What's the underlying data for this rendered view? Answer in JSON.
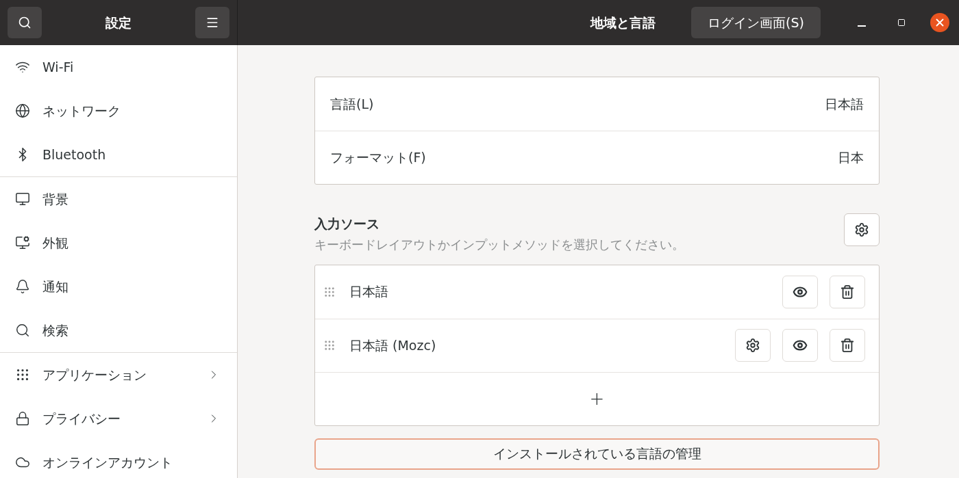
{
  "sidebar": {
    "title": "設定",
    "groups": [
      {
        "items": [
          {
            "label": "Wi-Fi",
            "kind": "page"
          },
          {
            "label": "ネットワーク",
            "kind": "page"
          },
          {
            "label": "Bluetooth",
            "kind": "page"
          }
        ]
      },
      {
        "items": [
          {
            "label": "背景",
            "kind": "page"
          },
          {
            "label": "外観",
            "kind": "page"
          },
          {
            "label": "通知",
            "kind": "page"
          },
          {
            "label": "検索",
            "kind": "page"
          }
        ]
      },
      {
        "items": [
          {
            "label": "アプリケーション",
            "kind": "submenu"
          },
          {
            "label": "プライバシー",
            "kind": "submenu"
          },
          {
            "label": "オンラインアカウント",
            "kind": "page"
          }
        ]
      }
    ]
  },
  "window": {
    "title": "地域と言語",
    "login_button": "ログイン画面(S)"
  },
  "language_settings": [
    {
      "label": "言語(L)",
      "value": "日本語"
    },
    {
      "label": "フォーマット(F)",
      "value": "日本"
    }
  ],
  "input_sources": {
    "title": "入力ソース",
    "description": "キーボードレイアウトかインプットメソッドを選択してください。",
    "items": [
      {
        "name": "日本語",
        "has_settings": false
      },
      {
        "name": "日本語 (Mozc)",
        "has_settings": true
      }
    ],
    "add_button": "+"
  },
  "manage_button": "インストールされている言語の管理"
}
